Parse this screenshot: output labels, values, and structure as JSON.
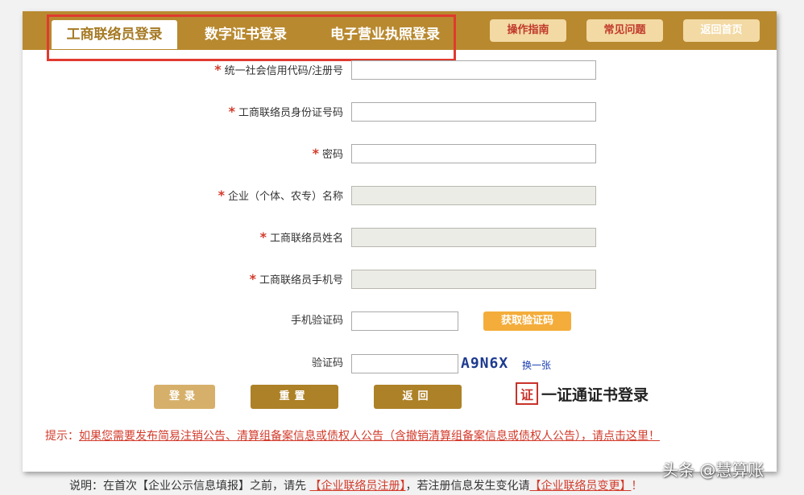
{
  "tabs": [
    {
      "label": "工商联络员登录"
    },
    {
      "label": "数字证书登录"
    },
    {
      "label": "电子营业执照登录"
    }
  ],
  "top_buttons": {
    "guide": "操作指南",
    "faq": "常见问题",
    "home": "返回首页"
  },
  "form": {
    "credit_code_label": "统一社会信用代码/注册号",
    "id_number_label": "工商联络员身份证号码",
    "password_label": "密码",
    "enterprise_name_label": "企业（个体、农专）名称",
    "contact_name_label": "工商联络员姓名",
    "contact_phone_label": "工商联络员手机号",
    "sms_code_label": "手机验证码",
    "captcha_label": "验证码",
    "required_mark": "*"
  },
  "get_code_button": "获取验证码",
  "captcha": {
    "text": "A9N6X",
    "refresh_link": "换一张"
  },
  "actions": {
    "login": "登录",
    "reset": "重置",
    "back": "返回"
  },
  "cert_login": {
    "icon_char": "证",
    "label": "一证通证书登录"
  },
  "hint": {
    "prefix": "提示：",
    "link": "如果您需要发布简易注销公告、清算组备案信息或债权人公告（含撤销清算组备案信息或债权人公告），请点击这里！"
  },
  "note": {
    "part1": "说明：在首次【企业公示信息填报】之前，请先",
    "link1": "【企业联络员注册】",
    "part2": "，若注册信息发生变化请",
    "link2": "【企业联络员变更】",
    "part3": "！"
  },
  "watermark": "头条 @慧算账",
  "colors": {
    "brand": "#b8892f",
    "accent_red": "#d23b2b",
    "orange": "#f4ad3b"
  }
}
